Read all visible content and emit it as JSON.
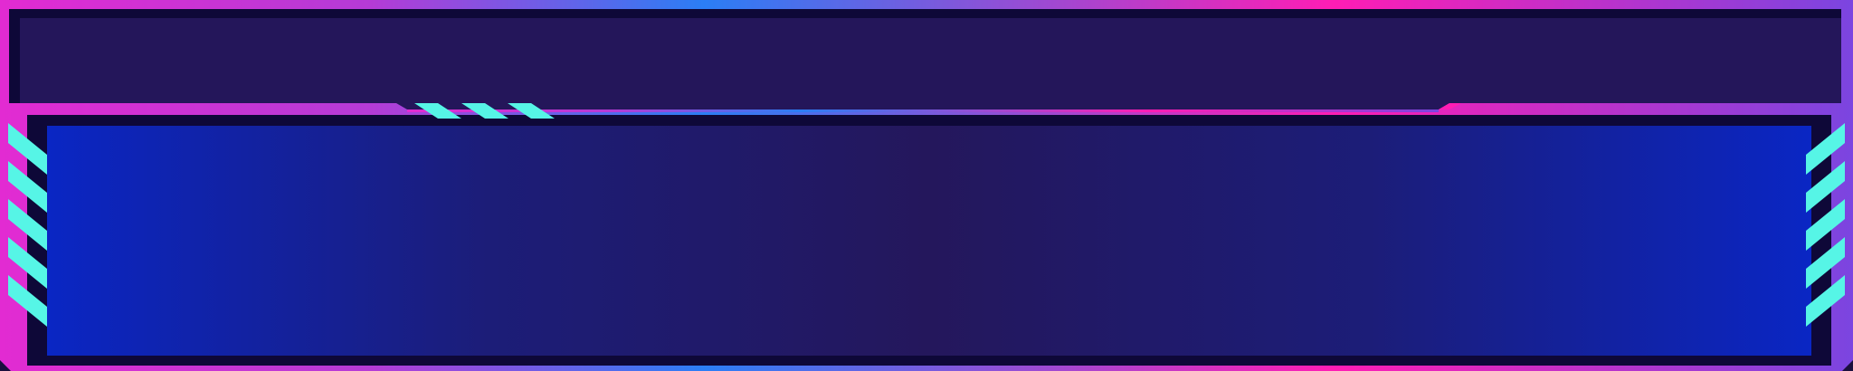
{
  "theme": {
    "frame_gradient": [
      "#e22bd2",
      "#b53bd6",
      "#2b7ef5",
      "#ff1db4",
      "#7b45e0"
    ],
    "header_fill": "#24165a",
    "inner_border": "#0e0838",
    "panel_edge": "#0a26c4",
    "panel_center": "#24175c",
    "accent_stripe": "#56f5e6"
  },
  "header": {
    "title": ""
  },
  "panel": {
    "content": ""
  }
}
